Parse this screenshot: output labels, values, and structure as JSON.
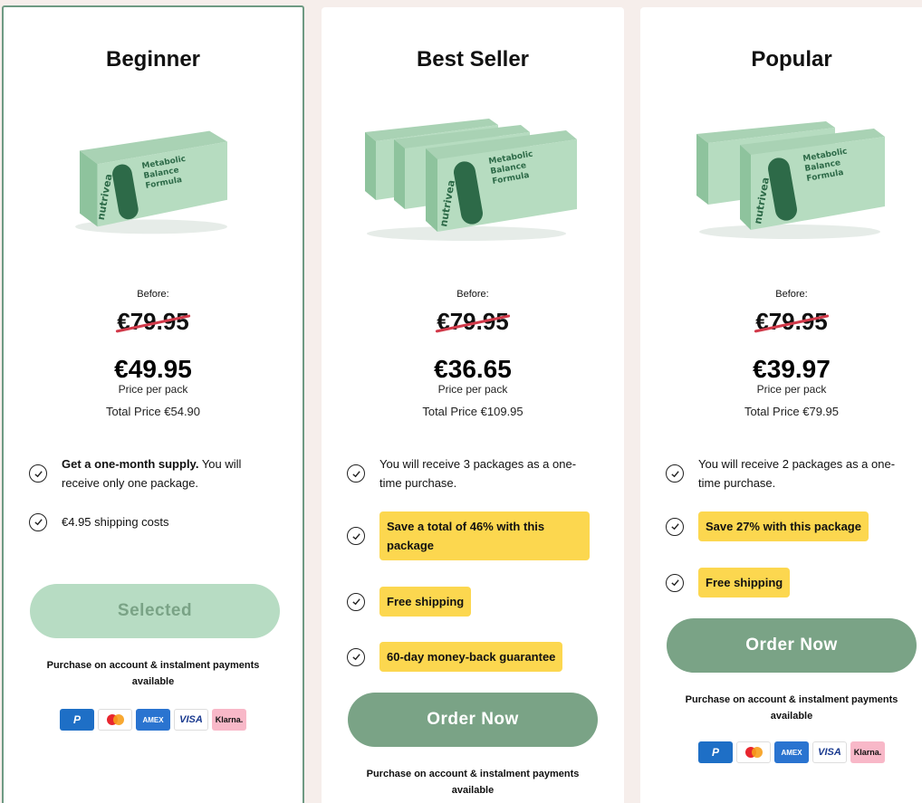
{
  "cards": [
    {
      "title": "Beginner",
      "before_label": "Before:",
      "old_price": "€79.95",
      "price": "€49.95",
      "per_pack": "Price per pack",
      "total": "Total Price €54.90",
      "features": [
        {
          "bold": "Get a one-month supply.",
          "text": " You will receive only one package."
        },
        {
          "bold": "",
          "text": "€4.95 shipping costs"
        }
      ],
      "button": "Selected",
      "purchase_note": "Purchase on account & instalment payments available"
    },
    {
      "title": "Best Seller",
      "before_label": "Before:",
      "old_price": "€79.95",
      "price": "€36.65",
      "per_pack": "Price per pack",
      "total": "Total Price €109.95",
      "features": [
        {
          "text": "You will receive 3 packages as a one-time purchase."
        },
        {
          "badge": "Save a total of 46% with this package"
        },
        {
          "badge": "Free shipping"
        },
        {
          "badge": "60-day money-back guarantee"
        }
      ],
      "button": "Order Now",
      "purchase_note": "Purchase on account & instalment payments available"
    },
    {
      "title": "Popular",
      "before_label": "Before:",
      "old_price": "€79.95",
      "price": "€39.97",
      "per_pack": "Price per pack",
      "total": "Total Price €79.95",
      "features": [
        {
          "text": "You will receive 2 packages as a one-time purchase."
        },
        {
          "badge": "Save 27% with this package"
        },
        {
          "badge": "Free shipping"
        }
      ],
      "button": "Order Now",
      "purchase_note": "Purchase on account & instalment payments available"
    }
  ],
  "product": {
    "brand": "nutrivea",
    "name_line1": "Metabolic",
    "name_line2": "Balance",
    "name_line3": "Formula"
  },
  "payments": {
    "paypal": "P",
    "amex": "AMEX",
    "visa": "VISA",
    "klarna": "Klarna."
  },
  "colors": {
    "button_green": "#7aa386",
    "selected_green": "#b7dcc3",
    "badge_yellow": "#fcd74f",
    "strike_red": "#d23a4a"
  }
}
